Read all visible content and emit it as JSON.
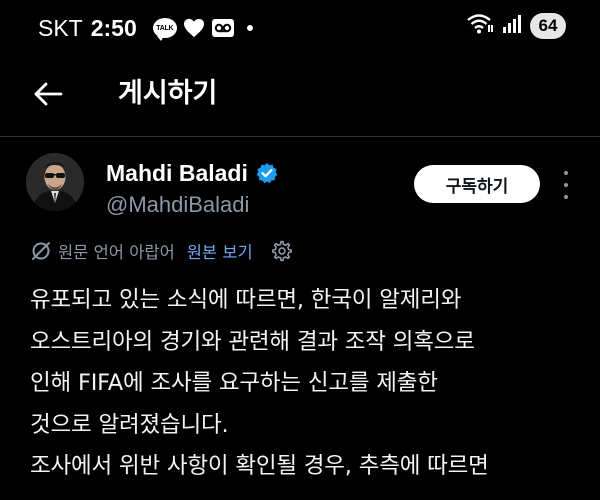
{
  "status_bar": {
    "carrier": "SKT",
    "time": "2:50",
    "talk_icon_text": "TALK",
    "battery": "64"
  },
  "header": {
    "title": "게시하기"
  },
  "post": {
    "author_name": "Mahdi Baladi",
    "author_handle": "@MahdiBaladi",
    "subscribe_label": "구독하기",
    "translation_note": "원문 언어 아랍어",
    "show_original_label": "원본 보기",
    "body_lines": [
      "유포되고 있는 소식에 따르면, 한국이 알제리와",
      "오스트리아의 경기와 관련해 결과 조작 의혹으로",
      "인해 FIFA에 조사를 요구하는 신고를 제출한",
      "것으로 알려졌습니다.",
      "조사에서 위반 사항이 확인될 경우, 추측에 따르면"
    ]
  },
  "colors": {
    "background": "#000000",
    "verified": "#1d9bf0",
    "link": "#6fa8f5",
    "muted": "#8b98a5"
  },
  "icons": [
    "talk-icon",
    "heart-icon",
    "voicemail-icon",
    "wifi-icon",
    "signal-icon",
    "back-arrow-icon",
    "verified-badge-icon",
    "more-options-icon",
    "translate-icon",
    "settings-gear-icon"
  ]
}
